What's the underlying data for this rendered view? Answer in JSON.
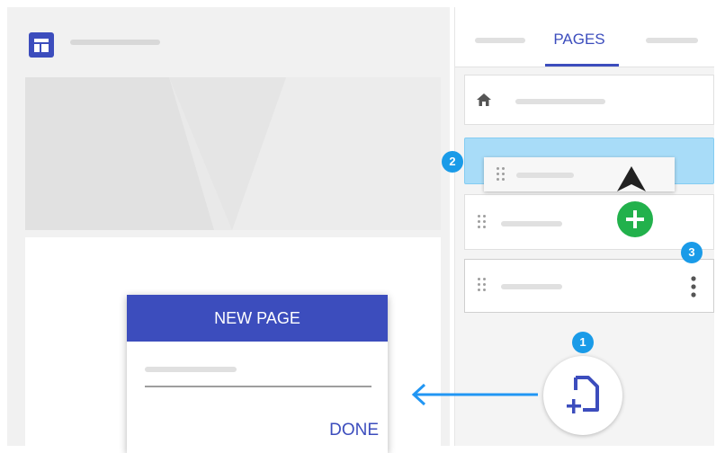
{
  "panel": {
    "tabs": [
      "PAGES"
    ],
    "active_tab": "PAGES"
  },
  "dialog": {
    "title": "NEW PAGE",
    "done_label": "DONE"
  },
  "steps": [
    "1",
    "2",
    "3"
  ],
  "colors": {
    "accent": "#3c4dbd",
    "step_badge": "#1a9be8",
    "add_button": "#22b14c",
    "selected_row": "#a8dcf8",
    "arrow": "#2196f3"
  },
  "icons": [
    "layout-icon",
    "home-icon",
    "drag-handle-icon",
    "more-vert-icon",
    "add-icon",
    "new-page-icon",
    "cursor-icon",
    "arrow-left-icon"
  ]
}
